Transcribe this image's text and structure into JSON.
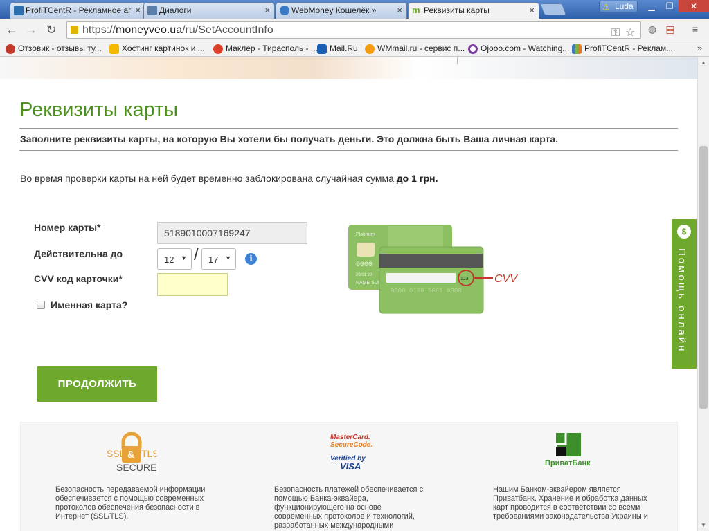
{
  "browser": {
    "tabs": [
      {
        "title": "ProfiTCentR - Рекламное аг",
        "favicon_color": "#2a6fb0"
      },
      {
        "title": "Диалоги",
        "favicon_color": "#5b7fa8"
      },
      {
        "title": "WebMoney Кошелёк »",
        "favicon_color": "#3a7bc8"
      },
      {
        "title": "Реквизиты карты",
        "favicon_color": "#6ea82c",
        "active": true
      }
    ],
    "user_name": "Luda",
    "url_scheme": "https://",
    "url_host": "moneyveo.ua",
    "url_path": "/ru/SetAccountInfo",
    "bookmarks": [
      {
        "label": "Отзовик - отзывы ту...",
        "icon_color": "#c0392b"
      },
      {
        "label": "Хостинг картинок и ...",
        "icon_color": "#f5b800"
      },
      {
        "label": "Маклер - Тирасполь - ...",
        "icon_color": "#d9412b"
      },
      {
        "label": "Mail.Ru",
        "icon_color": "#1a5fb4"
      },
      {
        "label": "WMmail.ru - сервис п...",
        "icon_color": "#f39c12"
      },
      {
        "label": "Ojooo.com - Watching...",
        "icon_color": "#7a3fa0"
      },
      {
        "label": "ProfiTCentR - Реклам...",
        "icon_color": "#3d7bbf"
      }
    ],
    "bookmarks_more": "»"
  },
  "page": {
    "title": "Реквизиты карты",
    "lead": "Заполните реквизиты карты, на которую Вы хотели бы получать деньги. Это должна быть Ваша личная карта.",
    "note_text": "Во время проверки карты на ней будет временно заблокирована случайная сумма ",
    "note_bold": "до 1 грн.",
    "form": {
      "card_number_label": "Номер карты*",
      "card_number_value": "5189010007169247",
      "valid_until_label": "Действительна до",
      "month_value": "12",
      "year_value": "17",
      "date_separator": "/",
      "cvv_label": "CVV код карточки*",
      "cvv_value": "",
      "named_card_label": "Именная карта?",
      "named_card_checked": false
    },
    "card_illustration": {
      "front_label": "Platinum",
      "front_number": "0000",
      "front_date": "20/01 20",
      "front_name": "NAME SUR",
      "back_number": "0000 0189 5661 0000",
      "signature_code": "123",
      "cvv_caption": "CVV"
    },
    "continue_button": "ПРОДОЛЖИТЬ",
    "help_button": "Помощь онлайн",
    "footer": {
      "ssl_logo_text": [
        "SSL",
        "&",
        "TLS",
        "SECURE"
      ],
      "mastercard_logo_text": [
        "MasterCard.",
        "SecureCode."
      ],
      "visa_logo_text": [
        "Verified by",
        "VISA"
      ],
      "privatbank_logo_text": "ПриватБанк",
      "texts": [
        "Безопасность передаваемой информации обеспечивается с помощью современных протоколов обеспечения безопасности в Интернет (SSL/TLS).",
        "Безопасность платежей обеспечивается с помощью Банка-эквайера, функционирующего на основе современных протоколов и технологий, разработанных международными",
        "Нашим Банком-эквайером является Приватбанк. Хранение и обработка данных карт проводится в соответствии со всеми требованиями законодательства Украины и"
      ]
    },
    "colors": {
      "brand_green": "#6ea82c",
      "title_green": "#4e8f1f",
      "cvv_red": "#c0392b"
    }
  }
}
